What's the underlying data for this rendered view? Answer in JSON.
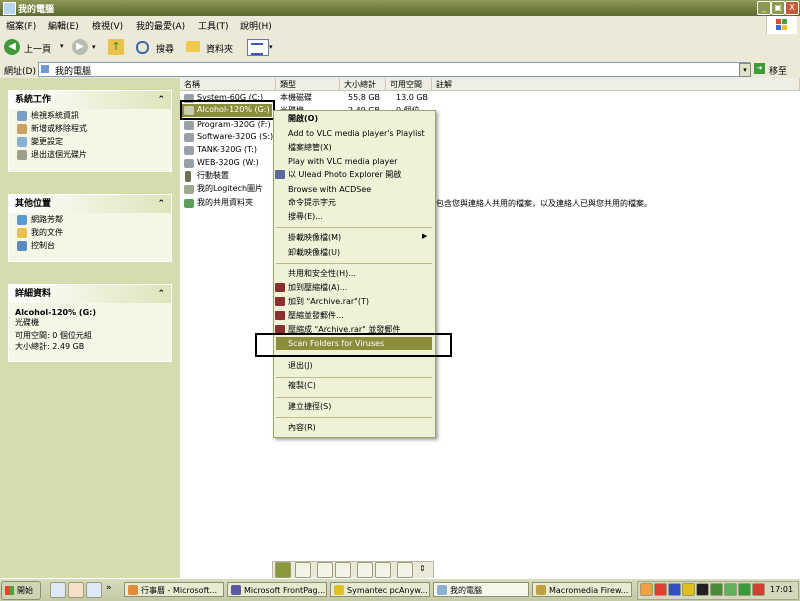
{
  "window": {
    "title": "我的電腦",
    "min": "_",
    "max": "▣",
    "close": "X"
  },
  "menubar": [
    "檔案(F)",
    "編輯(E)",
    "檢視(V)",
    "我的最愛(A)",
    "工具(T)",
    "說明(H)"
  ],
  "toolbar": {
    "back": "上一頁",
    "search": "搜尋",
    "folders": "資料夾"
  },
  "address": {
    "label": "網址(D)",
    "value": "我的電腦",
    "go": "移至"
  },
  "left": {
    "system_tasks": {
      "title": "系統工作",
      "items": [
        "檢視系統資訊",
        "新增或移除程式",
        "變更設定",
        "退出這個光碟片"
      ]
    },
    "other_places": {
      "title": "其他位置",
      "items": [
        "網路芳鄰",
        "我的文件",
        "控制台"
      ]
    },
    "details": {
      "title": "詳細資料",
      "name": "Alcohol-120% (G:)",
      "type": "光碟機",
      "free": "可用空間: 0 個位元組",
      "total": "大小總計: 2.49 GB"
    }
  },
  "columns": {
    "name": "名稱",
    "type": "類型",
    "total": "大小總計",
    "free": "可用空間",
    "note": "註解"
  },
  "files": [
    {
      "name": "System-60G (C:)",
      "type": "本機磁碟",
      "total": "55.8 GB",
      "free": "13.0 GB"
    },
    {
      "name": "Alcohol-120% (G:)",
      "type": "光碟機",
      "total": "2.49 GB",
      "free": "0 個位"
    },
    {
      "name": "Program-320G (F:)",
      "type": "",
      "total": "",
      "free": ""
    },
    {
      "name": "Software-320G (S:)",
      "type": "",
      "total": "",
      "free": ""
    },
    {
      "name": "TANK-320G (T:)",
      "type": "",
      "total": "",
      "free": ""
    },
    {
      "name": "WEB-320G (W:)",
      "type": "",
      "total": "",
      "free": ""
    },
    {
      "name": "行動裝置",
      "type": "",
      "total": "",
      "free": ""
    },
    {
      "name": "我的Logitech圖片",
      "type": "",
      "total": "",
      "free": ""
    },
    {
      "name": "我的共用資料夾",
      "type": "",
      "total": "",
      "free": ""
    }
  ],
  "shared_note": "包含您與連絡人共用的檔案，以及連絡人已與您共用的檔案。",
  "context_menu": [
    "開啟(O)",
    "Add to VLC media player's Playlist",
    "檔案總管(X)",
    "Play with VLC media player",
    "以 Ulead Photo Explorer 開啟",
    "Browse with ACDSee",
    "命令提示字元",
    "搜尋(E)...",
    "掛載映像檔(M)",
    "卸載映像檔(U)",
    "共用和安全性(H)...",
    "加到壓縮檔(A)...",
    "加到 \"Archive.rar\"(T)",
    "壓縮並發郵件...",
    "壓縮成 \"Archive.rar\" 並發郵件",
    "Scan Folders for Viruses",
    "退出(J)",
    "複製(C)",
    "建立捷徑(S)",
    "內容(R)"
  ],
  "taskbar": {
    "start": "開始",
    "clock": "17:01",
    "tasks": [
      "行事曆 - Microsoft...",
      "Microsoft FrontPag...",
      "Symantec pcAnyw...",
      "我的電腦",
      "Macromedia Firew..."
    ],
    "expand": "»"
  },
  "colors": {
    "title": "#6e7a3c",
    "highlight": "#8a8e3a",
    "left_pane": "#d6dcae",
    "menu_bg": "#f0f2d8"
  }
}
